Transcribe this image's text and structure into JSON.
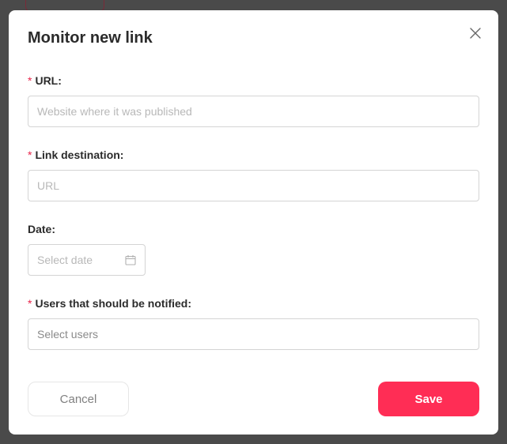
{
  "modal": {
    "title": "Monitor new link",
    "close_icon": "close-icon"
  },
  "fields": {
    "url": {
      "label": "URL:",
      "required": true,
      "placeholder": "Website where it was published",
      "value": ""
    },
    "link_destination": {
      "label": "Link destination:",
      "required": true,
      "placeholder": "URL",
      "value": ""
    },
    "date": {
      "label": "Date:",
      "required": false,
      "placeholder": "Select date",
      "icon": "calendar-icon"
    },
    "users": {
      "label": "Users that should be notified:",
      "required": true,
      "placeholder": "Select users"
    }
  },
  "required_marker": "*",
  "actions": {
    "cancel_label": "Cancel",
    "save_label": "Save"
  },
  "colors": {
    "accent": "#ff2d55",
    "required": "#e8244a",
    "backdrop": "#4a4a4a"
  }
}
